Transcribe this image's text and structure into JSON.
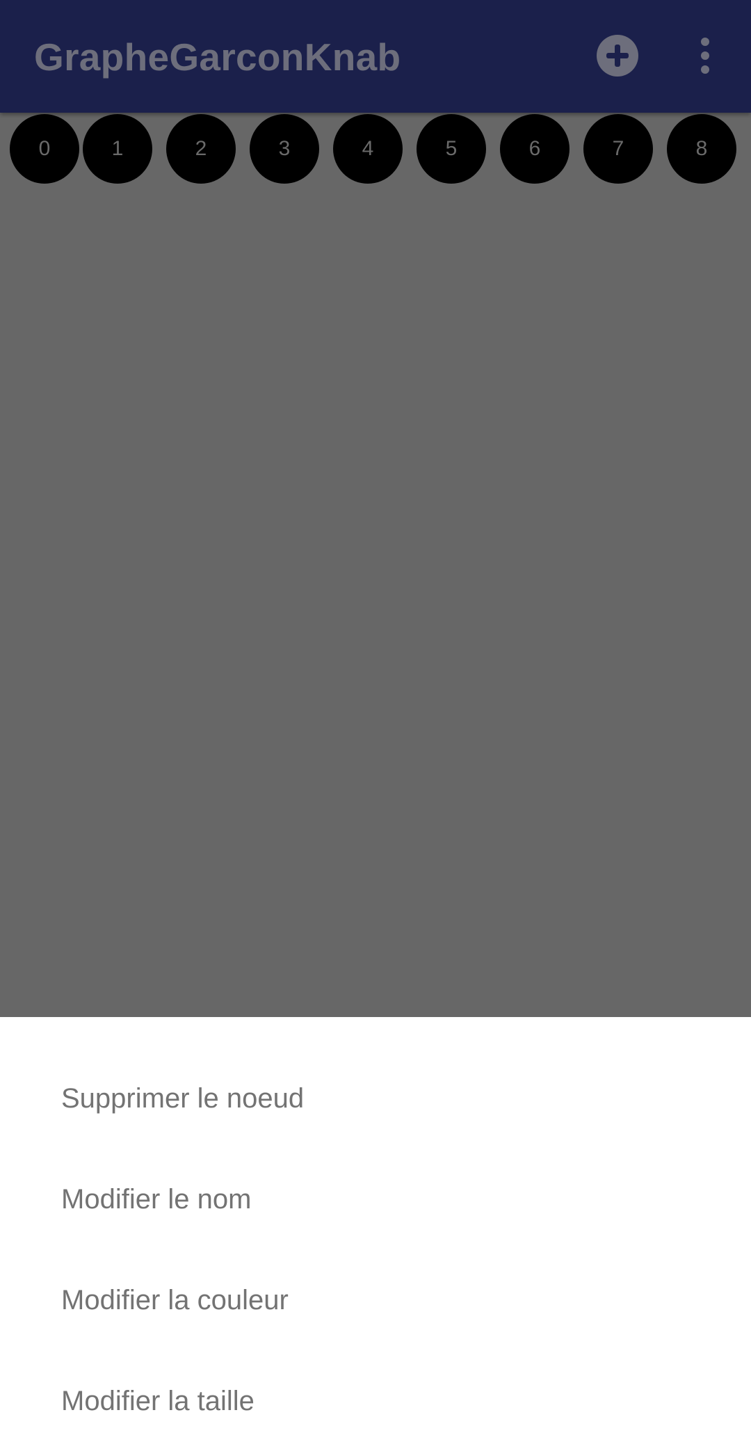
{
  "app_bar": {
    "title": "GrapheGarconKnab",
    "actions": [
      {
        "name": "add",
        "icon": "add-circle-icon"
      },
      {
        "name": "more",
        "icon": "more-vert-icon"
      }
    ]
  },
  "graph": {
    "nodes": [
      {
        "label": "0"
      },
      {
        "label": "1"
      },
      {
        "label": "2"
      },
      {
        "label": "3"
      },
      {
        "label": "4"
      },
      {
        "label": "5"
      },
      {
        "label": "6"
      },
      {
        "label": "7"
      },
      {
        "label": "8"
      }
    ]
  },
  "bottom_sheet": {
    "items": [
      {
        "label": "Supprimer le noeud"
      },
      {
        "label": "Modifier le nom"
      },
      {
        "label": "Modifier la couleur"
      },
      {
        "label": "Modifier la taille"
      }
    ]
  },
  "colors": {
    "app_bar": "#1b204b",
    "scrim_background": "#676767",
    "node_fill": "#000000",
    "sheet_background": "#ffffff"
  }
}
